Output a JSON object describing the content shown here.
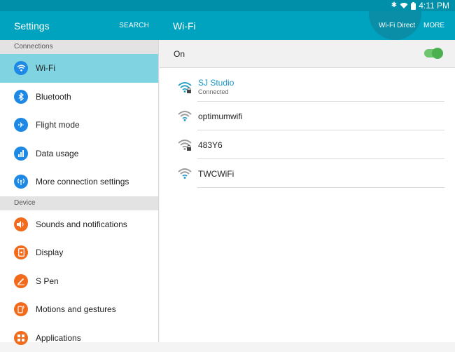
{
  "status_bar": {
    "time": "4:11 PM",
    "icons": [
      "bluetooth-icon",
      "wifi-icon",
      "battery-icon"
    ]
  },
  "left_header": {
    "title": "Settings",
    "search_label": "SEARCH"
  },
  "right_header": {
    "title": "Wi-Fi",
    "wifi_direct_label": "Wi-Fi Direct",
    "more_label": "MORE"
  },
  "sidebar": {
    "sections": [
      {
        "title": "Connections",
        "items": [
          {
            "label": "Wi-Fi",
            "icon": "wifi-icon",
            "active": true
          },
          {
            "label": "Bluetooth",
            "icon": "bluetooth-icon"
          },
          {
            "label": "Flight mode",
            "icon": "airplane-icon"
          },
          {
            "label": "Data usage",
            "icon": "data-usage-icon"
          },
          {
            "label": "More connection settings",
            "icon": "antenna-icon"
          }
        ]
      },
      {
        "title": "Device",
        "items": [
          {
            "label": "Sounds and notifications",
            "icon": "volume-icon"
          },
          {
            "label": "Display",
            "icon": "display-icon"
          },
          {
            "label": "S Pen",
            "icon": "pen-icon"
          },
          {
            "label": "Motions and gestures",
            "icon": "gesture-icon"
          },
          {
            "label": "Applications",
            "icon": "apps-icon"
          }
        ]
      }
    ]
  },
  "wifi": {
    "toggle_label": "On",
    "toggle_on": true,
    "networks": [
      {
        "name": "SJ Studio",
        "status": "Connected",
        "secured": true
      },
      {
        "name": "optimumwifi",
        "secured": false
      },
      {
        "name": "483Y6",
        "secured": true
      },
      {
        "name": "TWCWiFi",
        "secured": false
      }
    ]
  },
  "colors": {
    "header": "#00a3bf",
    "status_bar": "#008fa8",
    "active_item": "#80d4e2",
    "toggle": "#4caf50",
    "connected_text": "#1898c4"
  }
}
